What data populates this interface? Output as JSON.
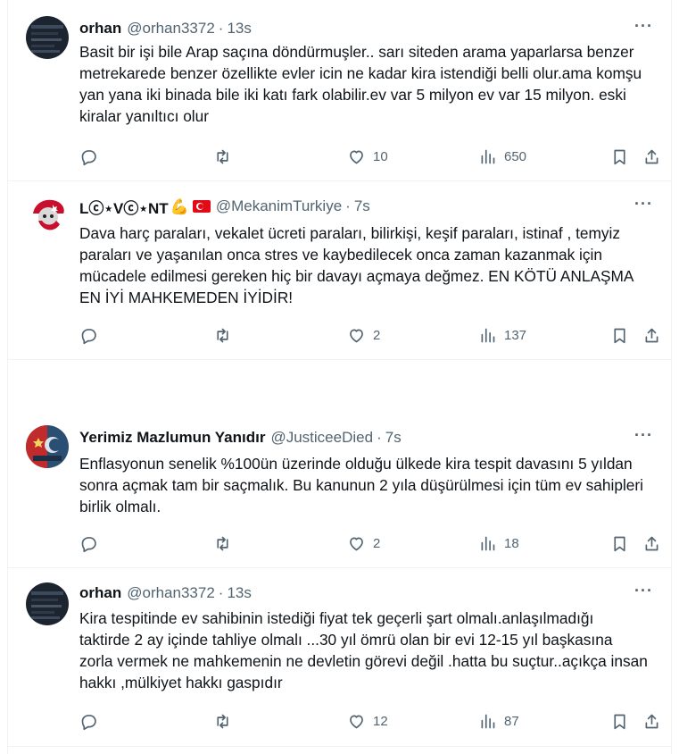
{
  "tweets": [
    {
      "name": "orhan",
      "handle": "@orhan3372",
      "time": "13s",
      "text": "Basit bir işi bile Arap saçına döndürmuşler.. sarı siteden arama yaparlarsa benzer metrekarede benzer özellikte evler icin ne kadar kira istendiği belli olur.ama komşu yan yana iki binada bile iki katı fark olabilir.ev var 5 milyon ev var 15 milyon. eski kiralar yanıltıcı olur",
      "reply_count": "",
      "repost_count": "",
      "like_count": "10",
      "view_count": "650"
    },
    {
      "name": "Lⓒ⋆Vⓒ⋆NT",
      "handle": "@MekanimTurkiye",
      "time": "7s",
      "text": "Dava harç paraları, vekalet ücreti paraları, bilirkişi, keşif paraları, istinaf , temyiz paraları ve yaşanılan onca stres ve kaybedilecek onca zaman kazanmak için mücadele edilmesi gereken hiç bir davayı açmaya değmez. EN KÖTÜ ANLAŞMA EN İYİ MAHKEMEDEN İYİDİR!",
      "reply_count": "",
      "repost_count": "",
      "like_count": "2",
      "view_count": "137"
    },
    {
      "name": "Yerimiz Mazlumun Yanıdır",
      "handle": "@JusticeeDied",
      "time": "7s",
      "text": "Enflasyonun senelik %100ün üzerinde olduğu ülkede kira tespit davasını 5 yıldan sonra açmak tam bir saçmalık. Bu kanunun 2 yıla düşürülmesi için tüm ev sahipleri birlik olmalı.",
      "reply_count": "",
      "repost_count": "",
      "like_count": "2",
      "view_count": "18"
    },
    {
      "name": "orhan",
      "handle": "@orhan3372",
      "time": "13s",
      "text": "Kira tespitinde ev sahibinin istediği fiyat tek geçerli şart olmalı.anlaşılmadığı taktirde 2 ay içinde tahliye olmalı ...30 yıl ömrü olan bir evi 12-15 yıl başkasına zorla vermek ne mahkemenin ne devletin görevi değil .hatta bu suçtur..açıkça insan hakkı ,mülkiyet hakkı gaspıdır",
      "reply_count": "",
      "repost_count": "",
      "like_count": "12",
      "view_count": "87"
    }
  ],
  "dot_separator": "·",
  "more_glyph": "···",
  "colors": {
    "muted": "#536471",
    "text": "#0f1419",
    "divider": "#eff3f4",
    "flag_red": "#e30a17"
  }
}
